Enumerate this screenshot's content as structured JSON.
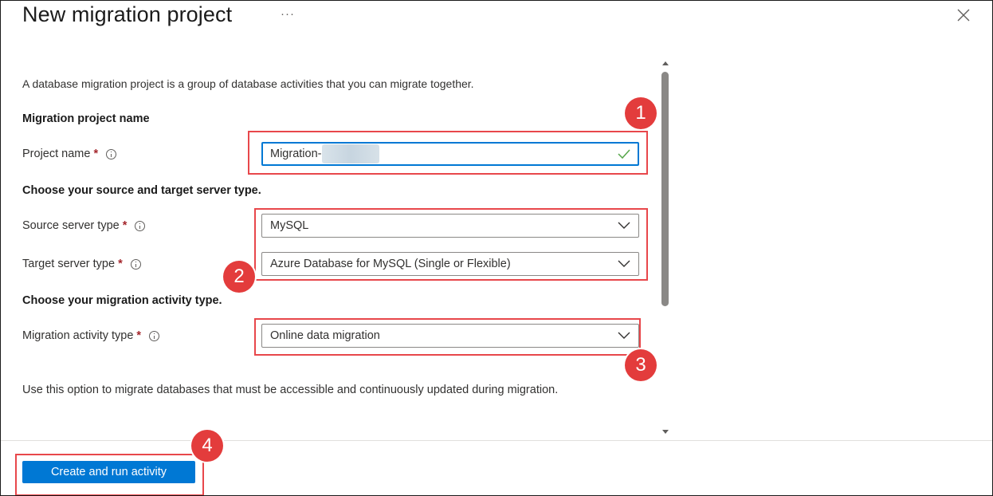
{
  "header": {
    "title": "New migration project",
    "more_label": "···"
  },
  "description": "A database migration project is a group of database activities that you can migrate together.",
  "sections": {
    "project_name": "Migration project name",
    "server_types": "Choose your source and target server type.",
    "activity_type": "Choose your migration activity type."
  },
  "fields": {
    "project_name": {
      "label": "Project name",
      "required": "*",
      "value": "Migration-"
    },
    "source_server_type": {
      "label": "Source server type",
      "required": "*",
      "value": "MySQL"
    },
    "target_server_type": {
      "label": "Target server type",
      "required": "*",
      "value": "Azure Database for MySQL (Single or Flexible)"
    },
    "migration_activity_type": {
      "label": "Migration activity type",
      "required": "*",
      "value": "Online data migration"
    }
  },
  "activity_hint": "Use this option to migrate databases that must be accessible and continuously updated during migration.",
  "footer": {
    "primary_button": "Create and run activity"
  },
  "callouts": [
    "1",
    "2",
    "3",
    "4"
  ],
  "colors": {
    "accent": "#0078d4",
    "callout": "#e33c3c",
    "valid": "#57a64a"
  },
  "icons": {
    "close": "close-icon",
    "info": "info-icon",
    "chevron": "chevron-down-icon",
    "check": "checkmark-icon"
  }
}
